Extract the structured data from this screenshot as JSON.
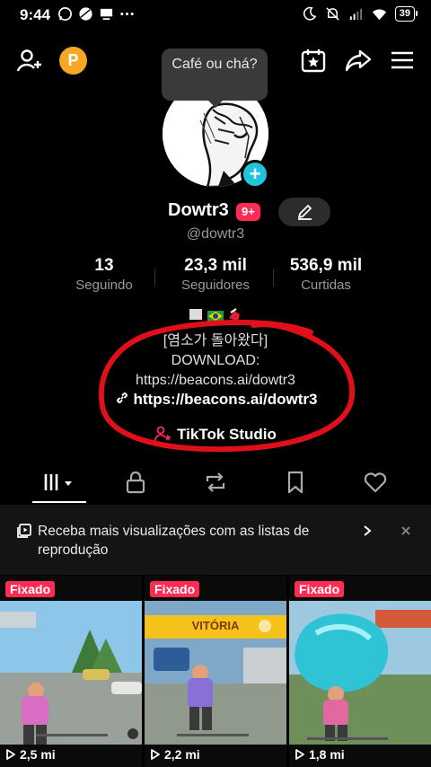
{
  "status": {
    "time": "9:44",
    "battery": "39"
  },
  "tooltip": {
    "text": "Café ou chá?"
  },
  "profile": {
    "username": "Dowtr3",
    "notifications": "9+",
    "handle": "@dowtr3",
    "badge_letter": "P"
  },
  "stats": [
    {
      "value": "13",
      "label": "Seguindo"
    },
    {
      "value": "23,3 mil",
      "label": "Seguidores"
    },
    {
      "value": "536,9 mil",
      "label": "Curtidas"
    }
  ],
  "bio": {
    "line1": "[염소가 돌아왔다]",
    "line2": "DOWNLOAD:",
    "line3": "https://beacons.ai/dowtr3",
    "link": "https://beacons.ai/dowtr3",
    "studio": "TikTok Studio"
  },
  "banner": {
    "text": "Receba mais visualizações com as listas de reprodução"
  },
  "videos": [
    {
      "pinned": "Fixado",
      "views": "2,5 mi"
    },
    {
      "pinned": "Fixado",
      "views": "2,2 mi",
      "overlay": "VITÓRIA"
    },
    {
      "pinned": "Fixado",
      "views": "1,8 mi"
    }
  ],
  "colors": {
    "accent": "#fe2c55",
    "cyan": "#20c4dc",
    "badge": "#f5a623",
    "circle": "#e0101a"
  }
}
